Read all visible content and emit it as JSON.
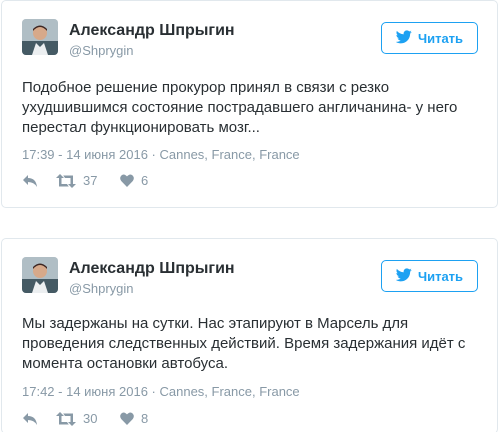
{
  "colors": {
    "accent": "#1da1f2",
    "text": "#292f33",
    "muted": "#8899a6",
    "border": "#e1e8ed"
  },
  "tweets": [
    {
      "display_name": "Александр Шпрыгин",
      "handle": "@Shprygin",
      "follow_label": "Читать",
      "text": "Подобное решение прокурор принял в связи с резко ухудшившимся состояние пострадавшего англичанина- у него перестал функционировать мозг...",
      "timestamp": "17:39 - 14 июня 2016",
      "location": "Cannes, France, France",
      "retweets": "37",
      "likes": "6",
      "icons": {
        "reply": "reply-icon",
        "retweet": "retweet-icon",
        "like": "heart-icon",
        "follow": "twitter-bird-icon"
      }
    },
    {
      "display_name": "Александр Шпрыгин",
      "handle": "@Shprygin",
      "follow_label": "Читать",
      "text": "Мы задержаны на сутки. Нас этапируют в Марсель для проведения следственных действий. Время задержания идёт с момента остановки автобуса.",
      "timestamp": "17:42 - 14 июня 2016",
      "location": "Cannes, France, France",
      "retweets": "30",
      "likes": "8",
      "icons": {
        "reply": "reply-icon",
        "retweet": "retweet-icon",
        "like": "heart-icon",
        "follow": "twitter-bird-icon"
      }
    }
  ]
}
